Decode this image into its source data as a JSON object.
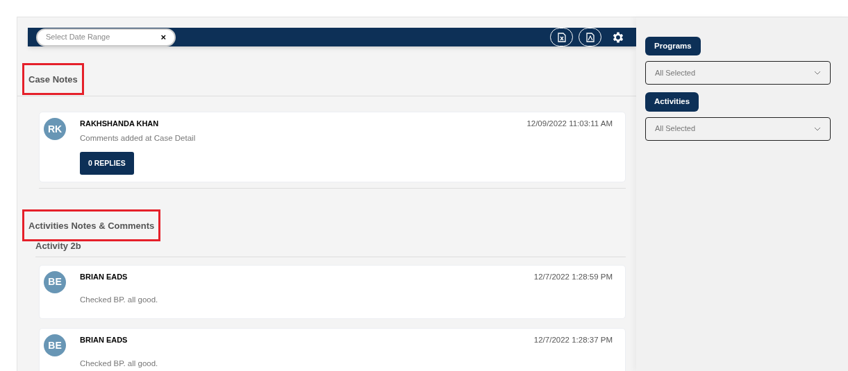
{
  "toolbar": {
    "date_range": {
      "placeholder": "Select Date Range",
      "clear": "×"
    }
  },
  "case_notes": {
    "heading": "Case Notes",
    "highlighted": true,
    "notes": [
      {
        "initials": "RK",
        "author": "RAKHSHANDA KHAN",
        "comment": "Comments added at Case Detail",
        "timestamp": "12/09/2022 11:03:11 AM",
        "replies": "0 REPLIES"
      }
    ]
  },
  "activity_notes": {
    "heading": "Activities Notes & Comments",
    "highlighted": true,
    "groups": [
      {
        "title": "Activity 2b",
        "notes": [
          {
            "initials": "BE",
            "author": "BRIAN EADS",
            "comment": "Checked BP. all good.",
            "timestamp": "12/7/2022 1:28:59 PM"
          },
          {
            "initials": "BE",
            "author": "BRIAN EADS",
            "comment": "Checked BP. all good.",
            "timestamp": "12/7/2022 1:28:37 PM"
          }
        ]
      }
    ]
  },
  "filters": [
    {
      "label": "Programs",
      "value": "All Selected"
    },
    {
      "label": "Activities",
      "value": "All Selected"
    }
  ]
}
